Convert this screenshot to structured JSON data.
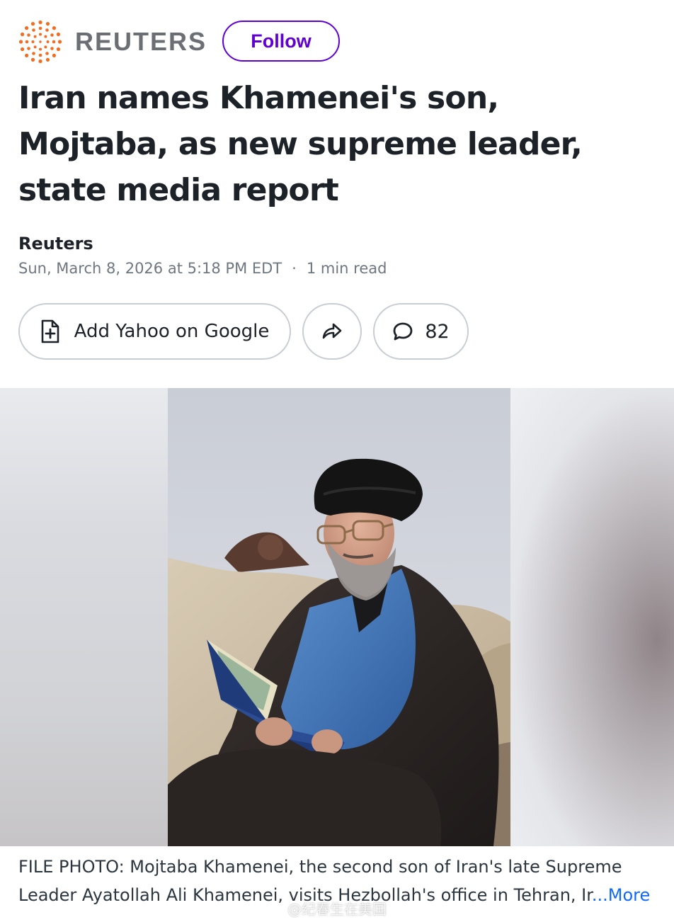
{
  "header": {
    "brand_name": "REUTERS",
    "brand_color": "#f26d21",
    "follow_label": "Follow",
    "follow_color": "#6001d2"
  },
  "article": {
    "headline": "Iran names Khamenei's son, Mojtaba, as new supreme leader, state media report",
    "author": "Reuters",
    "date": "Sun, March 8, 2026 at 5:18 PM EDT",
    "separator": "·",
    "read_time": "1 min read"
  },
  "actions": {
    "add_google_label": "Add Yahoo on Google",
    "share_icon": "share-arrow-icon",
    "comment_icon": "comment-bubble-icon",
    "comment_count": "82"
  },
  "photo": {
    "caption": "FILE PHOTO: Mojtaba Khamenei, the second son of Iran's late Supreme Leader Ayatollah Ali Khamenei, visits Hezbollah's office in Tehran, Ir",
    "more_label": "...More",
    "link_color": "#0f69ff"
  },
  "watermark": {
    "text": "@纪春生在美国"
  }
}
